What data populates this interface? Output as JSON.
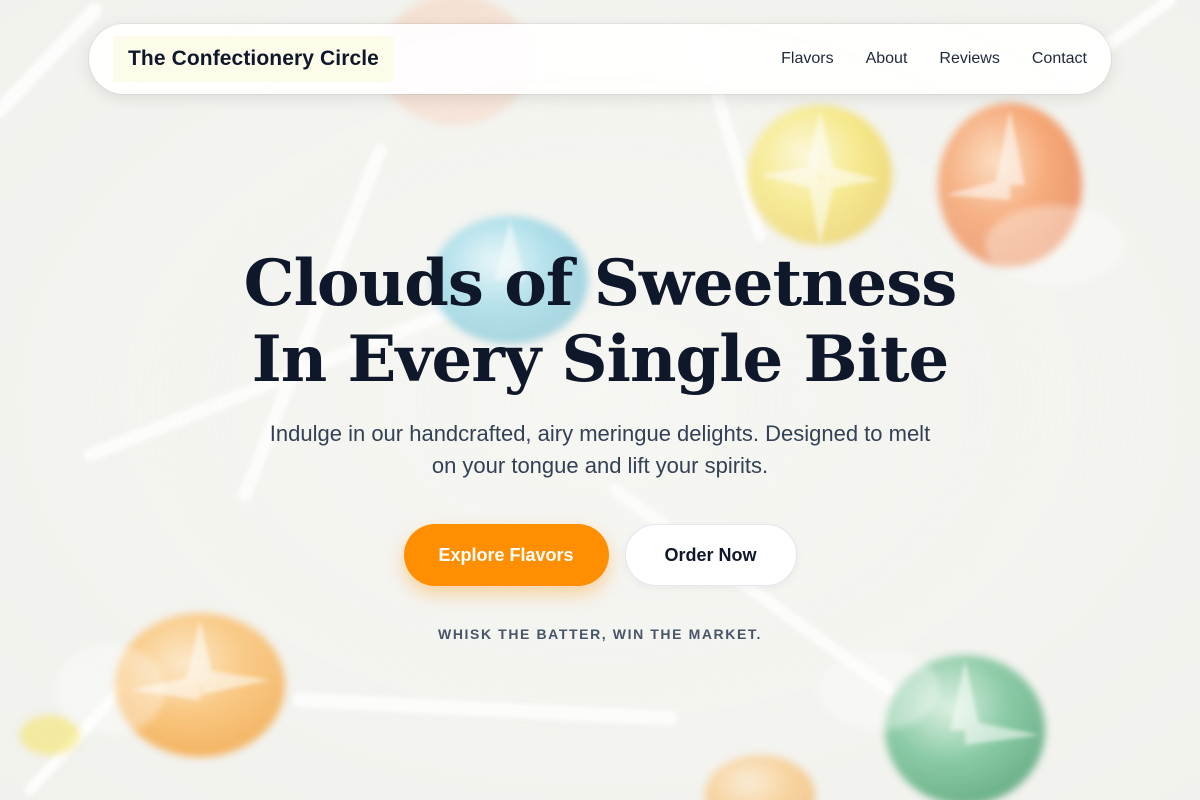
{
  "nav": {
    "brand": "The Confectionery Circle",
    "links": [
      "Flavors",
      "About",
      "Reviews",
      "Contact"
    ]
  },
  "hero": {
    "title_line1": "Clouds of Sweetness",
    "title_line2": "In Every Single Bite",
    "subtitle": "Indulge in our handcrafted, airy meringue delights. Designed to melt on your tongue and lift your spirits.",
    "primary_cta": "Explore Flavors",
    "secondary_cta": "Order Now",
    "tagline": "WHISK THE BATTER, WIN THE MARKET."
  },
  "colors": {
    "accent": "#ff8f00",
    "heading": "#0f172a",
    "body_text": "#334155"
  }
}
